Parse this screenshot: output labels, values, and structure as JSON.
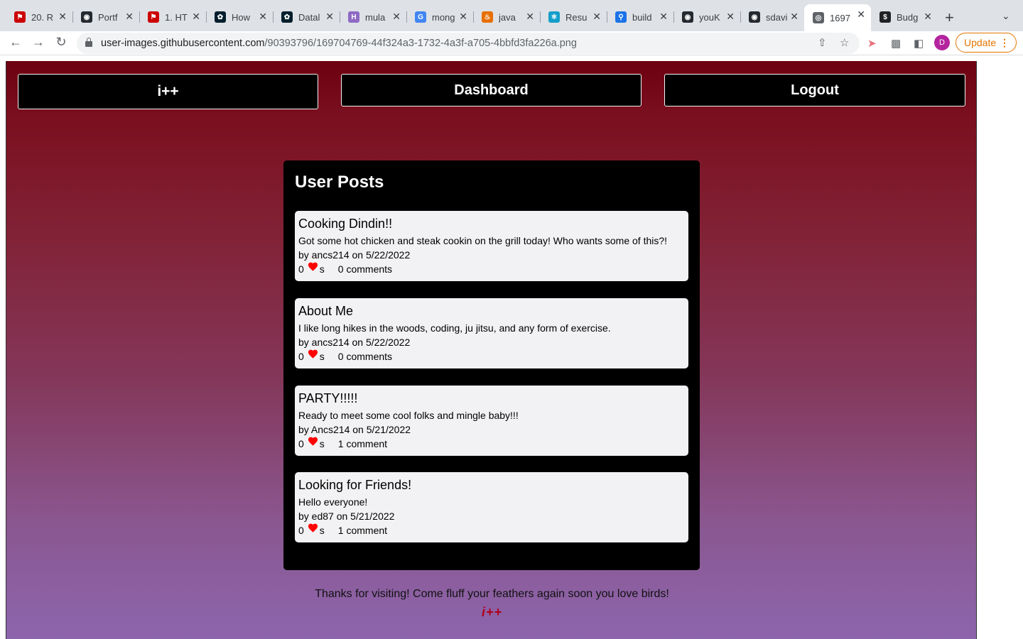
{
  "browser": {
    "tabs": [
      {
        "label": "20. R",
        "icon": "red-flag-icon",
        "color": "#cc0000"
      },
      {
        "label": "Portf",
        "icon": "github-icon",
        "color": "#24292f"
      },
      {
        "label": "1. HT",
        "icon": "red-flag-icon",
        "color": "#cc0000"
      },
      {
        "label": "How",
        "icon": "mongodb-leaf-icon",
        "color": "#001e2b"
      },
      {
        "label": "Datal",
        "icon": "mongodb-leaf-icon",
        "color": "#001e2b"
      },
      {
        "label": "mula",
        "icon": "hashnode-icon",
        "color": "#8e6ac3"
      },
      {
        "label": "mong",
        "icon": "google-icon",
        "color": "#4285f4"
      },
      {
        "label": "java",
        "icon": "java-icon",
        "color": "#e76f00"
      },
      {
        "label": "Resu",
        "icon": "react-icon",
        "color": "#149eca"
      },
      {
        "label": "build",
        "icon": "search-icon",
        "color": "#1a73e8"
      },
      {
        "label": "youK",
        "icon": "github-icon",
        "color": "#24292f"
      },
      {
        "label": "sdavi",
        "icon": "github-icon",
        "color": "#24292f"
      },
      {
        "label": "1697",
        "icon": "globe-icon",
        "color": "#5f6368"
      },
      {
        "label": "Budg",
        "icon": "money-bag-icon",
        "color": "#202124"
      }
    ],
    "url_host": "user-images.githubusercontent.com",
    "url_path": "/90393796/169704769-44f324a3-1732-4a3f-a705-4bbfd3fa226a.png",
    "profile_initial": "D",
    "update_label": "Update"
  },
  "nav": {
    "brand": "i++",
    "dashboard": "Dashboard",
    "logout": "Logout"
  },
  "panel": {
    "title": "User Posts"
  },
  "posts": [
    {
      "title": "Cooking Dindin!!",
      "body": "Got some hot chicken and steak cookin on the grill today! Who wants some of this?!",
      "meta": "by ancs214 on 5/22/2022",
      "likes": "0",
      "likes_suffix": "s",
      "comments": "0 comments"
    },
    {
      "title": "About Me",
      "body": "I like long hikes in the woods, coding, ju jitsu, and any form of exercise.",
      "meta": "by ancs214 on 5/22/2022",
      "likes": "0",
      "likes_suffix": "s",
      "comments": "0 comments"
    },
    {
      "title": "PARTY!!!!!",
      "body": "Ready to meet some cool folks and mingle baby!!!",
      "meta": "by Ancs214 on 5/21/2022",
      "likes": "0",
      "likes_suffix": "s",
      "comments": "1 comment"
    },
    {
      "title": "Looking for Friends!",
      "body": "Hello everyone!",
      "meta": "by ed87 on 5/21/2022",
      "likes": "0",
      "likes_suffix": "s",
      "comments": "1 comment"
    }
  ],
  "footer": {
    "text": "Thanks for visiting! Come fluff your feathers again soon you love birds!",
    "logo": "i++"
  },
  "colors": {
    "heart": "#ff0000",
    "gradient_top": "#6e0010",
    "gradient_bottom": "#8d65ad",
    "update_accent": "#e37400"
  }
}
